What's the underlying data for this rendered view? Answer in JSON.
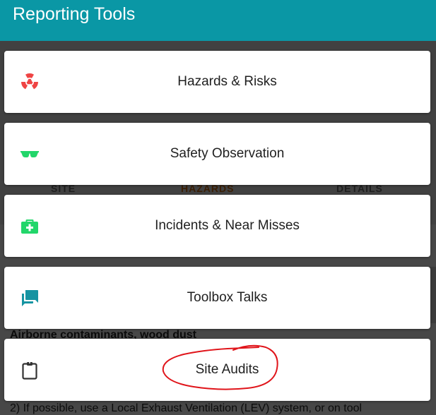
{
  "header": {
    "title": "Reporting Tools"
  },
  "background": {
    "tabs": [
      "SITE",
      "HAZARDS",
      "DETAILS"
    ],
    "line1": "Airborne contaminants, wood dust",
    "line2": "2) If possible, use a Local Exhaust Ventilation (LEV) system, or on tool"
  },
  "tools": [
    {
      "label": "Hazards & Risks",
      "icon": "radiation-icon",
      "icon_color": "#ef4444"
    },
    {
      "label": "Safety Observation",
      "icon": "glasses-icon",
      "icon_color": "#22d66a"
    },
    {
      "label": "Incidents & Near Misses",
      "icon": "first-aid-kit-icon",
      "icon_color": "#22d66a"
    },
    {
      "label": "Toolbox Talks",
      "icon": "chat-bubbles-icon",
      "icon_color": "#1694a2"
    },
    {
      "label": "Site Audits",
      "icon": "clipboard-icon",
      "icon_color": "#333333"
    }
  ],
  "colors": {
    "header": "#0a97a5",
    "annotation": "#e0141a"
  }
}
